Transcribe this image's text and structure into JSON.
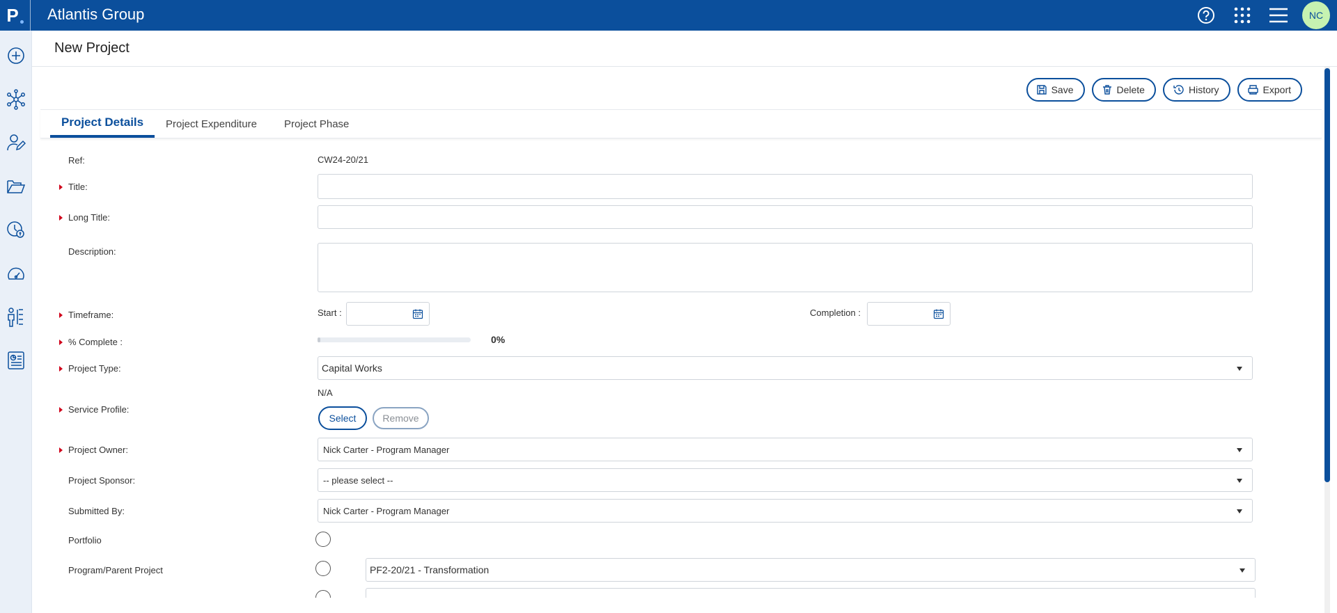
{
  "topbar": {
    "logo_letter": "P",
    "app_title": "Atlantis Group",
    "avatar_initials": "NC",
    "icons": [
      "help-icon",
      "apps-grid-icon",
      "menu-icon"
    ]
  },
  "sidebar": {
    "items": [
      "add-icon",
      "network-icon",
      "user-edit-icon",
      "folders-icon",
      "time-money-icon",
      "dashboard-icon",
      "org-chart-icon",
      "report-icon"
    ]
  },
  "page": {
    "title": "New Project"
  },
  "actions": {
    "save": "Save",
    "delete": "Delete",
    "history": "History",
    "export": "Export"
  },
  "tabs": [
    "Project Details",
    "Project Expenditure",
    "Project Phase"
  ],
  "form": {
    "ref_label": "Ref:",
    "ref_value": "CW24-20/21",
    "title_label": "Title:",
    "title_value": "",
    "long_title_label": "Long Title:",
    "long_title_value": "",
    "description_label": "Description:",
    "description_value": "",
    "timeframe_label": "Timeframe:",
    "start_label": "Start :",
    "start_value": "",
    "completion_label": "Completion :",
    "completion_value": "",
    "percent_label": "% Complete :",
    "percent_value": "0%",
    "percent_fraction": 0,
    "project_type_label": "Project Type:",
    "project_type_value": "Capital Works",
    "service_profile_label": "Service Profile:",
    "service_profile_value": "N/A",
    "select_btn": "Select",
    "remove_btn": "Remove",
    "owner_label": "Project Owner:",
    "owner_value": "Nick Carter - Program Manager",
    "sponsor_label": "Project Sponsor:",
    "sponsor_value": "-- please select --",
    "submitted_label": "Submitted By:",
    "submitted_value": "Nick Carter - Program Manager",
    "portfolio_label": "Portfolio",
    "parent_label": "Program/Parent Project",
    "parent_value": "PF2-20/21 - Transformation"
  },
  "colors": {
    "brand": "#0b4f9c",
    "required": "#d0021b",
    "avatar_bg": "#c6f2b1"
  }
}
